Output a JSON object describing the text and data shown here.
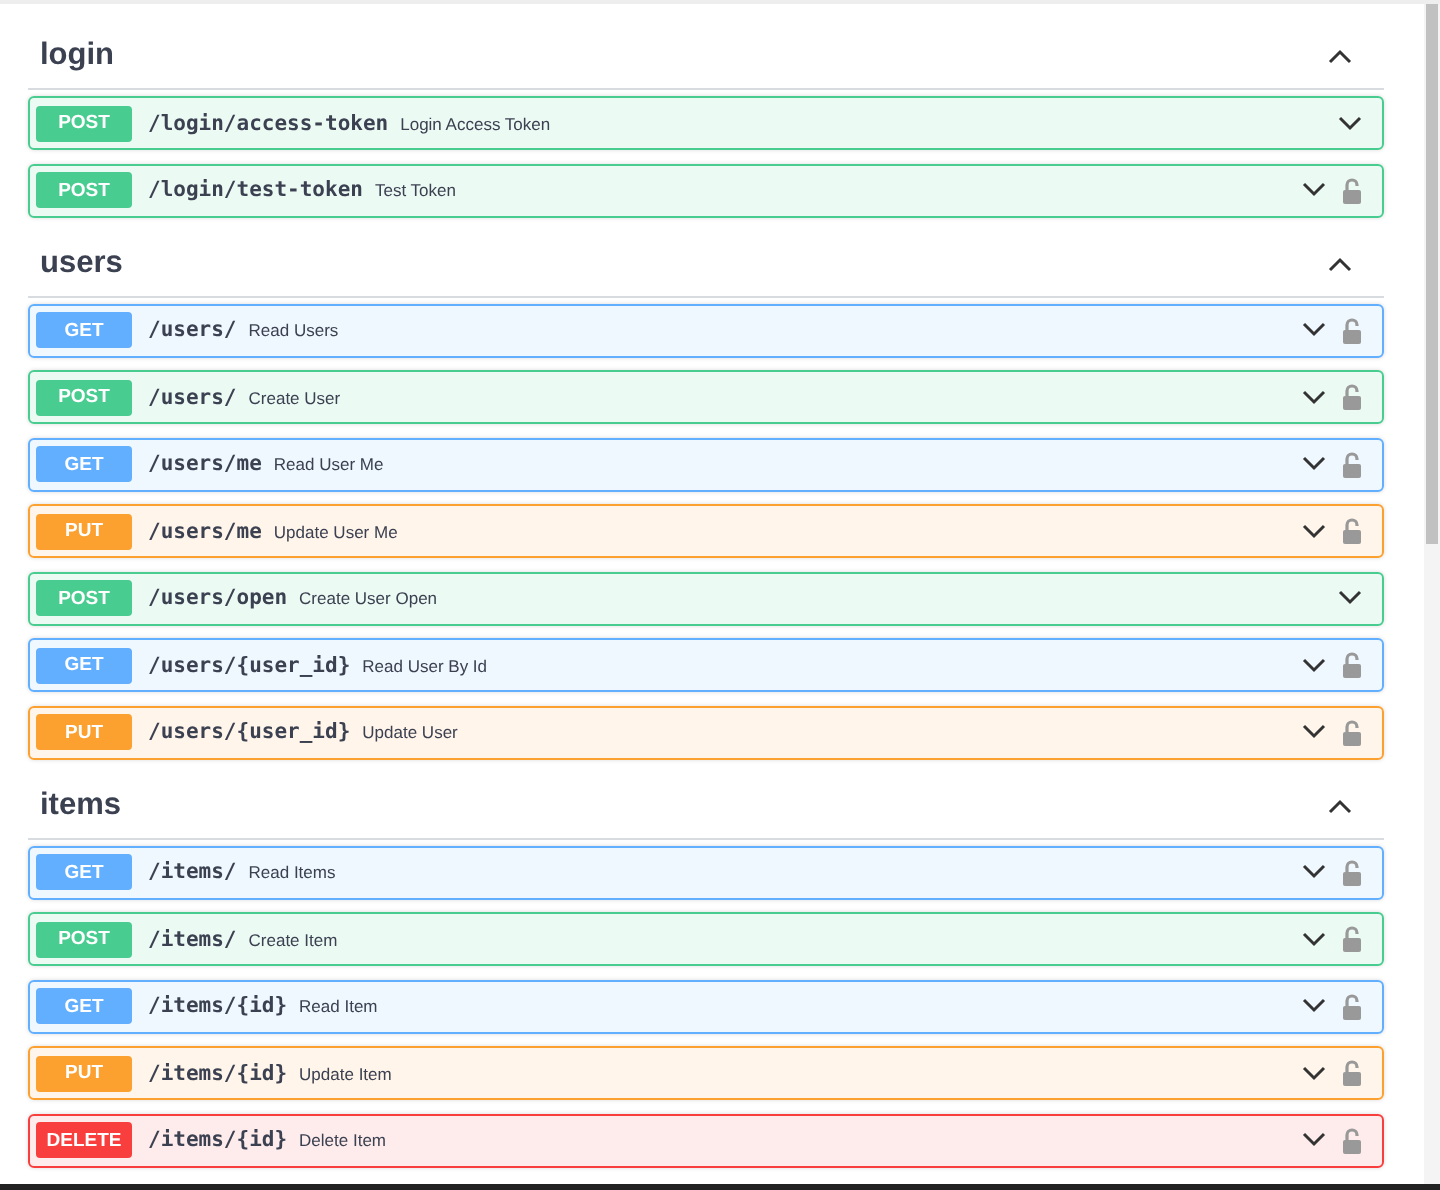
{
  "sections": [
    {
      "name": "login",
      "expanded": true,
      "operations": [
        {
          "method": "POST",
          "path": "/login/access-token",
          "summary": "Login Access Token",
          "locked": false
        },
        {
          "method": "POST",
          "path": "/login/test-token",
          "summary": "Test Token",
          "locked": true
        }
      ]
    },
    {
      "name": "users",
      "expanded": true,
      "operations": [
        {
          "method": "GET",
          "path": "/users/",
          "summary": "Read Users",
          "locked": true
        },
        {
          "method": "POST",
          "path": "/users/",
          "summary": "Create User",
          "locked": true
        },
        {
          "method": "GET",
          "path": "/users/me",
          "summary": "Read User Me",
          "locked": true
        },
        {
          "method": "PUT",
          "path": "/users/me",
          "summary": "Update User Me",
          "locked": true
        },
        {
          "method": "POST",
          "path": "/users/open",
          "summary": "Create User Open",
          "locked": false
        },
        {
          "method": "GET",
          "path": "/users/{user_id}",
          "summary": "Read User By Id",
          "locked": true
        },
        {
          "method": "PUT",
          "path": "/users/{user_id}",
          "summary": "Update User",
          "locked": true
        }
      ]
    },
    {
      "name": "items",
      "expanded": true,
      "operations": [
        {
          "method": "GET",
          "path": "/items/",
          "summary": "Read Items",
          "locked": true
        },
        {
          "method": "POST",
          "path": "/items/",
          "summary": "Create Item",
          "locked": true
        },
        {
          "method": "GET",
          "path": "/items/{id}",
          "summary": "Read Item",
          "locked": true
        },
        {
          "method": "PUT",
          "path": "/items/{id}",
          "summary": "Update Item",
          "locked": true
        },
        {
          "method": "DELETE",
          "path": "/items/{id}",
          "summary": "Delete Item",
          "locked": true
        }
      ]
    }
  ]
}
